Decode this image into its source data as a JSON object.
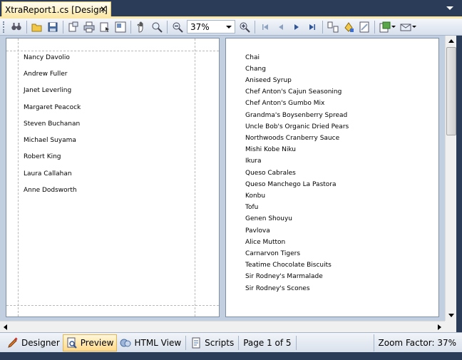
{
  "document_tab": {
    "title": "XtraReport1.cs [Design]",
    "close_glyph": "✕"
  },
  "toolbar": {
    "zoom_value": "37%",
    "buttons": [
      "search-icon",
      "open-icon",
      "save-icon",
      "page-setup-icon",
      "print-icon",
      "quick-print-icon",
      "page-layout-icon",
      "hand-tool-icon",
      "magnifier-icon",
      "zoom-out-icon",
      "zoom-in-icon",
      "first-page-icon",
      "previous-page-icon",
      "next-page-icon",
      "last-page-icon",
      "multiple-pages-icon",
      "background-color-icon",
      "watermark-icon",
      "export-icon",
      "email-icon"
    ]
  },
  "page1": {
    "employees": [
      "Nancy Davolio",
      "Andrew Fuller",
      "Janet Leverling",
      "Margaret Peacock",
      "Steven Buchanan",
      "Michael Suyama",
      "Robert King",
      "Laura Callahan",
      "Anne Dodsworth"
    ]
  },
  "page2": {
    "products": [
      "Chai",
      "Chang",
      "Aniseed Syrup",
      "Chef Anton's Cajun Seasoning",
      "Chef Anton's Gumbo Mix",
      "Grandma's Boysenberry Spread",
      "Uncle Bob's Organic Dried Pears",
      "Northwoods Cranberry Sauce",
      "Mishi Kobe Niku",
      "Ikura",
      "Queso Cabrales",
      "Queso Manchego La Pastora",
      "Konbu",
      "Tofu",
      "Genen Shouyu",
      "Pavlova",
      "Alice Mutton",
      "Carnarvon Tigers",
      "Teatime Chocolate Biscuits",
      "Sir Rodney's Marmalade",
      "Sir Rodney's Scones"
    ]
  },
  "statusbar": {
    "designer_label": "Designer",
    "preview_label": "Preview",
    "html_view_label": "HTML View",
    "scripts_label": "Scripts",
    "page_info": "Page 1 of 5",
    "zoom_factor": "Zoom Factor: 37%"
  },
  "colors": {
    "frame": "#2b3c59",
    "preview_bg": "#c2cfe0",
    "active_tab": "#fbe8a6"
  }
}
